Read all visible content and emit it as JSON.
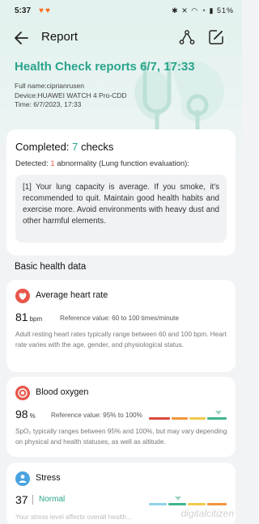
{
  "status_bar": {
    "time": "5:37",
    "notif_icons": "♥♥",
    "right_icons": "✱ ✕ ◠ ◔ ▮ 51%"
  },
  "header": {
    "title": "Report",
    "back_icon": "back-arrow-icon",
    "share_icon": "share-icon",
    "edit_icon": "edit-icon",
    "report_title": "Health Check reports 6/7, 17:33",
    "full_name": "Full name:ciprianrusen",
    "device": "Device:HUAWEI WATCH 4 Pro-CDD",
    "time": "Time: 6/7/2023, 17:33"
  },
  "summary": {
    "completed_prefix": "Completed: ",
    "completed_count": "7",
    "completed_suffix": " checks",
    "detected_prefix": "Detected: ",
    "detected_count": "1",
    "detected_suffix": " abnormality (Lung function evaluation):",
    "advice": "[1] Your lung capacity is average. If you smoke, it's recommended to quit. Maintain good health habits and exercise more. Avoid environments with heavy dust and other harmful elements."
  },
  "basic_health": {
    "section_title": "Basic health data",
    "heart_rate": {
      "title": "Average heart rate",
      "icon": "heart-icon",
      "value": "81",
      "unit": "bpm",
      "reference": "Reference value: 60 to 100 times/minute",
      "description": "Adult resting heart rates typically range between 60 and 100 bpm. Heart rate varies with the age, gender, and physiological status."
    },
    "blood_oxygen": {
      "title": "Blood oxygen",
      "icon": "blood-drop-icon",
      "value": "98",
      "unit": "%",
      "reference": "Reference value: 95% to 100%",
      "description": "SpO₂ typically ranges between 95% and 100%, but may vary depending on physical and health statuses, as well as altitude.",
      "scale_position": 0.9
    },
    "stress": {
      "title": "Stress",
      "icon": "stress-icon",
      "value": "37",
      "level": "Normal",
      "description": "Your stress level affects overall health...",
      "scale_position": 0.38
    }
  },
  "watermark": "digitalcitizen",
  "colors": {
    "accent": "#29a48c",
    "alert": "#e8564a",
    "scale_red": "#d94a3b",
    "scale_orange": "#f0963c",
    "scale_yellow": "#f2c94c",
    "scale_green": "#3fb68b"
  }
}
